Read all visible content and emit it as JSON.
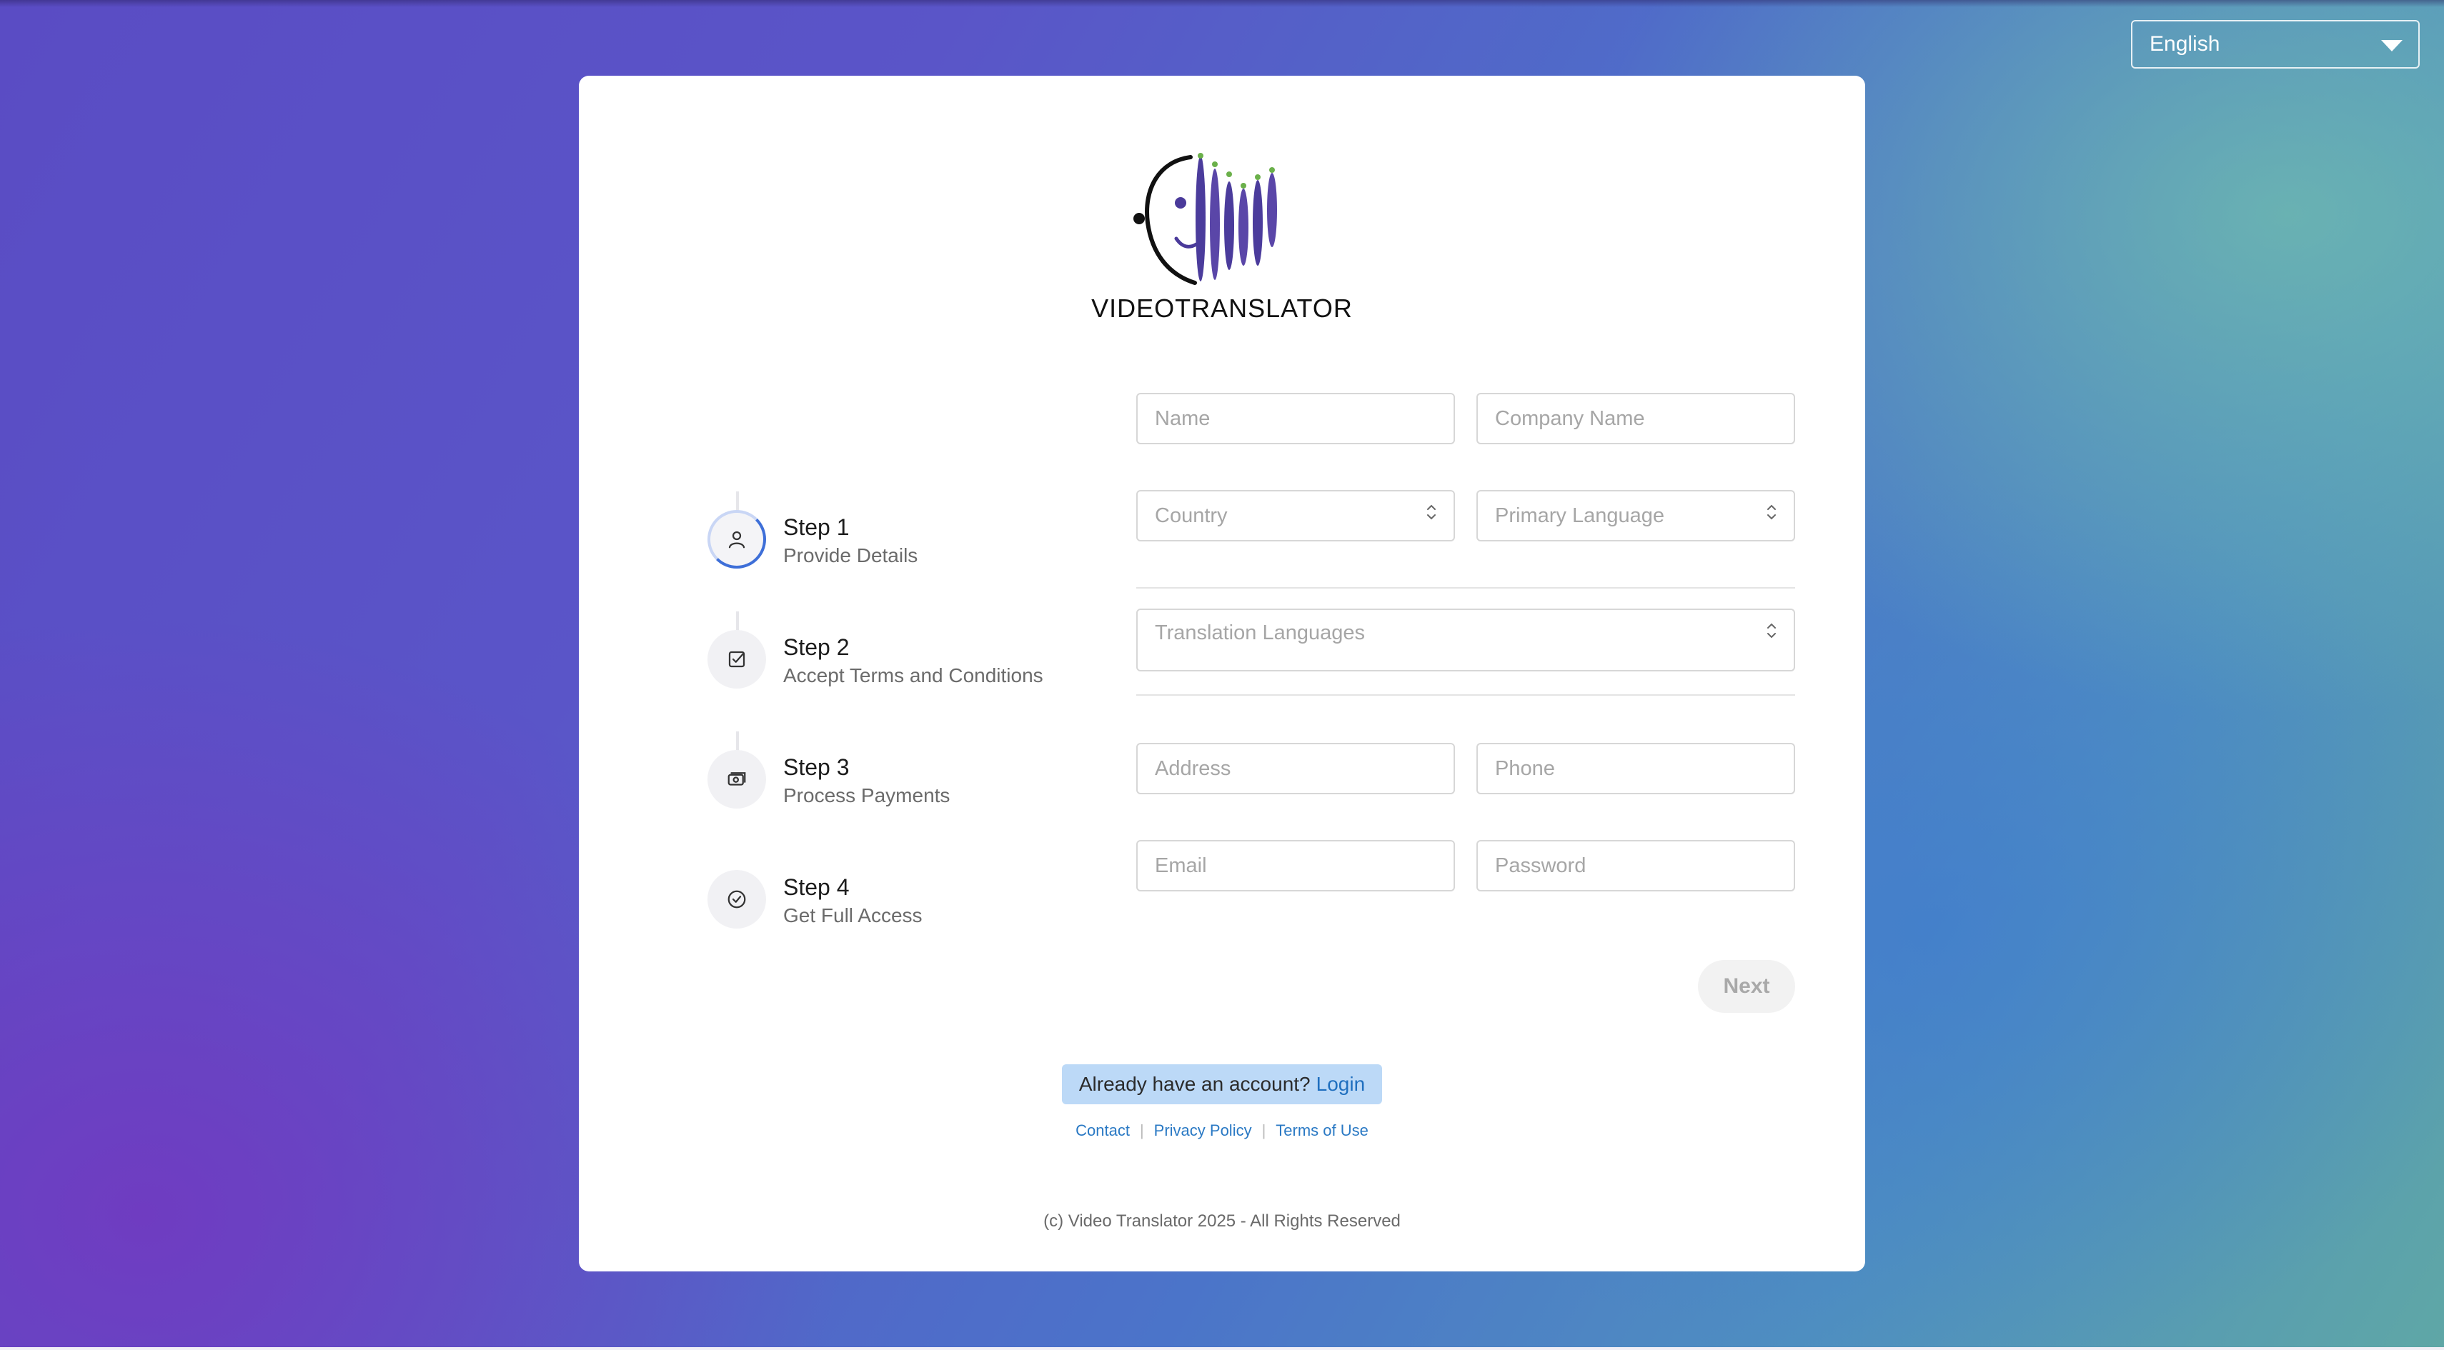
{
  "language_select": {
    "value": "English"
  },
  "brand": {
    "name": "VIDEOTRANSLATOR"
  },
  "steps": [
    {
      "title": "Step 1",
      "subtitle": "Provide Details",
      "icon": "user-icon",
      "active": true
    },
    {
      "title": "Step 2",
      "subtitle": "Accept Terms and Conditions",
      "icon": "checkbox-icon",
      "active": false
    },
    {
      "title": "Step 3",
      "subtitle": "Process Payments",
      "icon": "payment-icon",
      "active": false
    },
    {
      "title": "Step 4",
      "subtitle": "Get Full Access",
      "icon": "check-circle-icon",
      "active": false
    }
  ],
  "form": {
    "name": {
      "placeholder": "Name",
      "value": ""
    },
    "company": {
      "placeholder": "Company Name",
      "value": ""
    },
    "country": {
      "placeholder": "Country"
    },
    "primary_language": {
      "placeholder": "Primary Language"
    },
    "translation_languages": {
      "placeholder": "Translation Languages"
    },
    "address": {
      "placeholder": "Address",
      "value": ""
    },
    "phone": {
      "placeholder": "Phone",
      "value": ""
    },
    "email": {
      "placeholder": "Email",
      "value": ""
    },
    "password": {
      "placeholder": "Password",
      "value": ""
    },
    "next_label": "Next"
  },
  "login_prompt": {
    "text": "Already have an account?",
    "link": "Login"
  },
  "footer_links": {
    "contact": "Contact",
    "privacy": "Privacy Policy",
    "terms": "Terms of Use"
  },
  "copyright": "(c) Video Translator 2025 - All Rights Reserved",
  "colors": {
    "accent": "#3e6fd8",
    "link": "#2a79c4",
    "login_bg": "#bcd9f7"
  }
}
